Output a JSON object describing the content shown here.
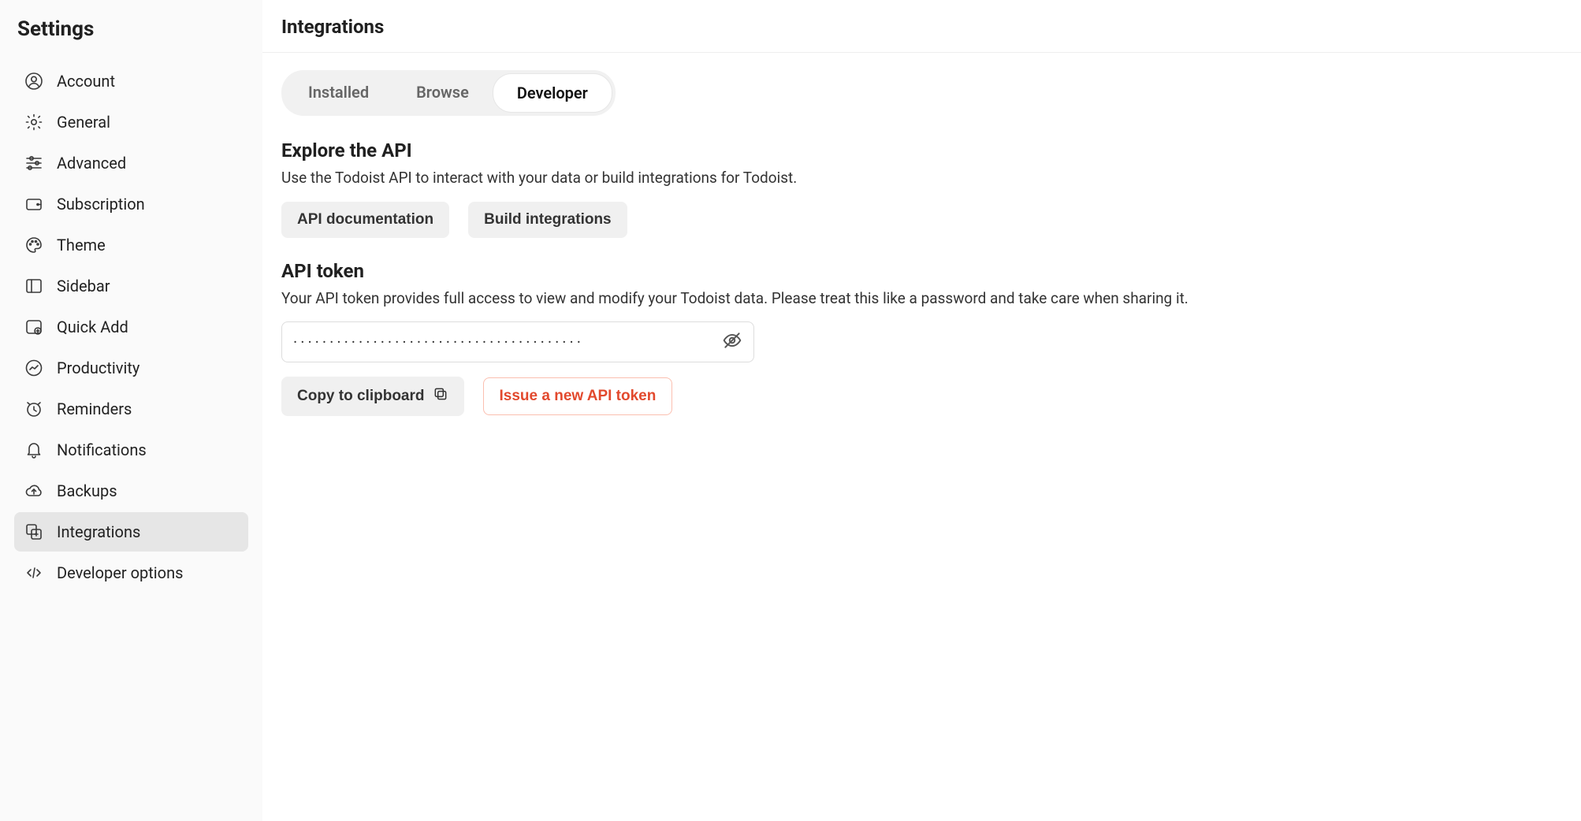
{
  "sidebar": {
    "title": "Settings",
    "items": [
      {
        "label": "Account"
      },
      {
        "label": "General"
      },
      {
        "label": "Advanced"
      },
      {
        "label": "Subscription"
      },
      {
        "label": "Theme"
      },
      {
        "label": "Sidebar"
      },
      {
        "label": "Quick Add"
      },
      {
        "label": "Productivity"
      },
      {
        "label": "Reminders"
      },
      {
        "label": "Notifications"
      },
      {
        "label": "Backups"
      },
      {
        "label": "Integrations"
      },
      {
        "label": "Developer options"
      }
    ]
  },
  "header": {
    "title": "Integrations"
  },
  "tabs": {
    "installed": "Installed",
    "browse": "Browse",
    "developer": "Developer"
  },
  "explore": {
    "title": "Explore the API",
    "desc": "Use the Todoist API to interact with your data or build integrations for Todoist.",
    "doc_btn": "API documentation",
    "build_btn": "Build integrations"
  },
  "token": {
    "title": "API token",
    "desc": "Your API token provides full access to view and modify your Todoist data. Please treat this like a password and take care when sharing it.",
    "masked_value": "········································",
    "copy_btn": "Copy to clipboard",
    "new_btn": "Issue a new API token"
  }
}
